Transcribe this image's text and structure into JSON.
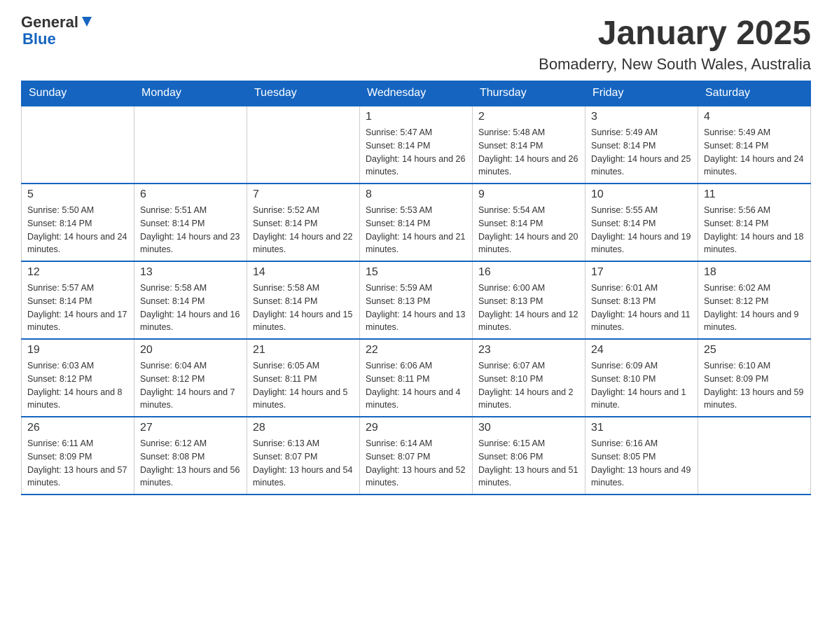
{
  "header": {
    "logo": {
      "general": "General",
      "blue": "Blue"
    },
    "title": "January 2025",
    "subtitle": "Bomaderry, New South Wales, Australia"
  },
  "days_of_week": [
    "Sunday",
    "Monday",
    "Tuesday",
    "Wednesday",
    "Thursday",
    "Friday",
    "Saturday"
  ],
  "weeks": [
    [
      {
        "day": "",
        "sunrise": "",
        "sunset": "",
        "daylight": ""
      },
      {
        "day": "",
        "sunrise": "",
        "sunset": "",
        "daylight": ""
      },
      {
        "day": "",
        "sunrise": "",
        "sunset": "",
        "daylight": ""
      },
      {
        "day": "1",
        "sunrise": "Sunrise: 5:47 AM",
        "sunset": "Sunset: 8:14 PM",
        "daylight": "Daylight: 14 hours and 26 minutes."
      },
      {
        "day": "2",
        "sunrise": "Sunrise: 5:48 AM",
        "sunset": "Sunset: 8:14 PM",
        "daylight": "Daylight: 14 hours and 26 minutes."
      },
      {
        "day": "3",
        "sunrise": "Sunrise: 5:49 AM",
        "sunset": "Sunset: 8:14 PM",
        "daylight": "Daylight: 14 hours and 25 minutes."
      },
      {
        "day": "4",
        "sunrise": "Sunrise: 5:49 AM",
        "sunset": "Sunset: 8:14 PM",
        "daylight": "Daylight: 14 hours and 24 minutes."
      }
    ],
    [
      {
        "day": "5",
        "sunrise": "Sunrise: 5:50 AM",
        "sunset": "Sunset: 8:14 PM",
        "daylight": "Daylight: 14 hours and 24 minutes."
      },
      {
        "day": "6",
        "sunrise": "Sunrise: 5:51 AM",
        "sunset": "Sunset: 8:14 PM",
        "daylight": "Daylight: 14 hours and 23 minutes."
      },
      {
        "day": "7",
        "sunrise": "Sunrise: 5:52 AM",
        "sunset": "Sunset: 8:14 PM",
        "daylight": "Daylight: 14 hours and 22 minutes."
      },
      {
        "day": "8",
        "sunrise": "Sunrise: 5:53 AM",
        "sunset": "Sunset: 8:14 PM",
        "daylight": "Daylight: 14 hours and 21 minutes."
      },
      {
        "day": "9",
        "sunrise": "Sunrise: 5:54 AM",
        "sunset": "Sunset: 8:14 PM",
        "daylight": "Daylight: 14 hours and 20 minutes."
      },
      {
        "day": "10",
        "sunrise": "Sunrise: 5:55 AM",
        "sunset": "Sunset: 8:14 PM",
        "daylight": "Daylight: 14 hours and 19 minutes."
      },
      {
        "day": "11",
        "sunrise": "Sunrise: 5:56 AM",
        "sunset": "Sunset: 8:14 PM",
        "daylight": "Daylight: 14 hours and 18 minutes."
      }
    ],
    [
      {
        "day": "12",
        "sunrise": "Sunrise: 5:57 AM",
        "sunset": "Sunset: 8:14 PM",
        "daylight": "Daylight: 14 hours and 17 minutes."
      },
      {
        "day": "13",
        "sunrise": "Sunrise: 5:58 AM",
        "sunset": "Sunset: 8:14 PM",
        "daylight": "Daylight: 14 hours and 16 minutes."
      },
      {
        "day": "14",
        "sunrise": "Sunrise: 5:58 AM",
        "sunset": "Sunset: 8:14 PM",
        "daylight": "Daylight: 14 hours and 15 minutes."
      },
      {
        "day": "15",
        "sunrise": "Sunrise: 5:59 AM",
        "sunset": "Sunset: 8:13 PM",
        "daylight": "Daylight: 14 hours and 13 minutes."
      },
      {
        "day": "16",
        "sunrise": "Sunrise: 6:00 AM",
        "sunset": "Sunset: 8:13 PM",
        "daylight": "Daylight: 14 hours and 12 minutes."
      },
      {
        "day": "17",
        "sunrise": "Sunrise: 6:01 AM",
        "sunset": "Sunset: 8:13 PM",
        "daylight": "Daylight: 14 hours and 11 minutes."
      },
      {
        "day": "18",
        "sunrise": "Sunrise: 6:02 AM",
        "sunset": "Sunset: 8:12 PM",
        "daylight": "Daylight: 14 hours and 9 minutes."
      }
    ],
    [
      {
        "day": "19",
        "sunrise": "Sunrise: 6:03 AM",
        "sunset": "Sunset: 8:12 PM",
        "daylight": "Daylight: 14 hours and 8 minutes."
      },
      {
        "day": "20",
        "sunrise": "Sunrise: 6:04 AM",
        "sunset": "Sunset: 8:12 PM",
        "daylight": "Daylight: 14 hours and 7 minutes."
      },
      {
        "day": "21",
        "sunrise": "Sunrise: 6:05 AM",
        "sunset": "Sunset: 8:11 PM",
        "daylight": "Daylight: 14 hours and 5 minutes."
      },
      {
        "day": "22",
        "sunrise": "Sunrise: 6:06 AM",
        "sunset": "Sunset: 8:11 PM",
        "daylight": "Daylight: 14 hours and 4 minutes."
      },
      {
        "day": "23",
        "sunrise": "Sunrise: 6:07 AM",
        "sunset": "Sunset: 8:10 PM",
        "daylight": "Daylight: 14 hours and 2 minutes."
      },
      {
        "day": "24",
        "sunrise": "Sunrise: 6:09 AM",
        "sunset": "Sunset: 8:10 PM",
        "daylight": "Daylight: 14 hours and 1 minute."
      },
      {
        "day": "25",
        "sunrise": "Sunrise: 6:10 AM",
        "sunset": "Sunset: 8:09 PM",
        "daylight": "Daylight: 13 hours and 59 minutes."
      }
    ],
    [
      {
        "day": "26",
        "sunrise": "Sunrise: 6:11 AM",
        "sunset": "Sunset: 8:09 PM",
        "daylight": "Daylight: 13 hours and 57 minutes."
      },
      {
        "day": "27",
        "sunrise": "Sunrise: 6:12 AM",
        "sunset": "Sunset: 8:08 PM",
        "daylight": "Daylight: 13 hours and 56 minutes."
      },
      {
        "day": "28",
        "sunrise": "Sunrise: 6:13 AM",
        "sunset": "Sunset: 8:07 PM",
        "daylight": "Daylight: 13 hours and 54 minutes."
      },
      {
        "day": "29",
        "sunrise": "Sunrise: 6:14 AM",
        "sunset": "Sunset: 8:07 PM",
        "daylight": "Daylight: 13 hours and 52 minutes."
      },
      {
        "day": "30",
        "sunrise": "Sunrise: 6:15 AM",
        "sunset": "Sunset: 8:06 PM",
        "daylight": "Daylight: 13 hours and 51 minutes."
      },
      {
        "day": "31",
        "sunrise": "Sunrise: 6:16 AM",
        "sunset": "Sunset: 8:05 PM",
        "daylight": "Daylight: 13 hours and 49 minutes."
      },
      {
        "day": "",
        "sunrise": "",
        "sunset": "",
        "daylight": ""
      }
    ]
  ]
}
